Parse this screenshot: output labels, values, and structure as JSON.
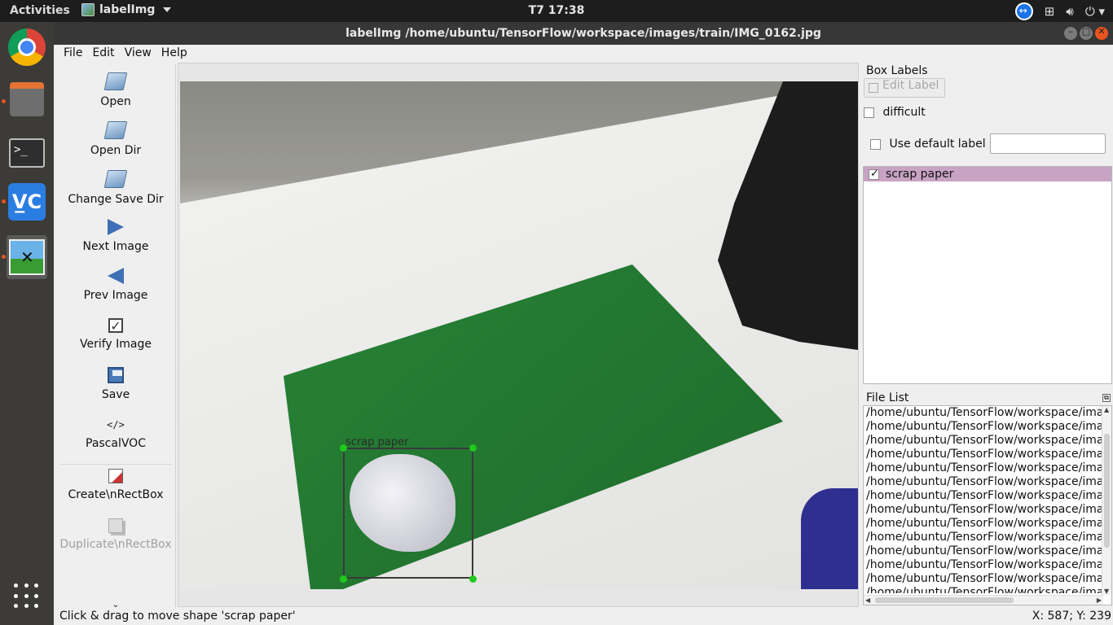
{
  "topbar": {
    "activities": "Activities",
    "app_name": "labelImg",
    "clock": "T7 17:38",
    "tray_icons": [
      "teamviewer-icon",
      "network-icon",
      "volume-icon",
      "power-icon"
    ]
  },
  "dock": {
    "items": [
      "chrome-icon",
      "files-icon",
      "terminal-icon",
      "vnc-icon",
      "labelimg-icon"
    ],
    "show_apps": "apps-grid-icon"
  },
  "window": {
    "title": "labelImg /home/ubuntu/TensorFlow/workspace/images/train/IMG_0162.jpg"
  },
  "menubar": {
    "file": "File",
    "edit": "Edit",
    "view": "View",
    "help": "Help"
  },
  "toolbar": {
    "open": "Open",
    "open_dir": "Open Dir",
    "change_save_dir": "Change Save Dir",
    "next_image": "Next Image",
    "prev_image": "Prev Image",
    "verify_image": "Verify Image",
    "save": "Save",
    "format_icon": "</>",
    "format": "PascalVOC",
    "create_rect": "Create\\nRectBox",
    "duplicate_rect": "Duplicate\\nRectBox",
    "more": "⌄"
  },
  "canvas": {
    "box_label": "scrap paper"
  },
  "box_labels_panel": {
    "title": "Box Labels",
    "edit_label": "Edit Label",
    "difficult": "difficult",
    "use_default_label": "Use default label",
    "default_label_value": "",
    "labels": [
      {
        "text": "scrap paper",
        "checked": true
      }
    ]
  },
  "file_list_panel": {
    "title": "File List",
    "items": [
      "/home/ubuntu/TensorFlow/workspace/ima",
      "/home/ubuntu/TensorFlow/workspace/ima",
      "/home/ubuntu/TensorFlow/workspace/ima",
      "/home/ubuntu/TensorFlow/workspace/ima",
      "/home/ubuntu/TensorFlow/workspace/ima",
      "/home/ubuntu/TensorFlow/workspace/ima",
      "/home/ubuntu/TensorFlow/workspace/ima",
      "/home/ubuntu/TensorFlow/workspace/ima",
      "/home/ubuntu/TensorFlow/workspace/ima",
      "/home/ubuntu/TensorFlow/workspace/ima",
      "/home/ubuntu/TensorFlow/workspace/ima",
      "/home/ubuntu/TensorFlow/workspace/ima",
      "/home/ubuntu/TensorFlow/workspace/ima",
      "/home/ubuntu/TensorFlow/workspace/ima"
    ]
  },
  "statusbar": {
    "message": "Click & drag to move shape 'scrap paper'",
    "coords": "X: 587; Y: 239"
  },
  "colors": {
    "accent": "#e95420",
    "label_highlight": "#c9a3c4",
    "handle": "#1ec91e"
  }
}
